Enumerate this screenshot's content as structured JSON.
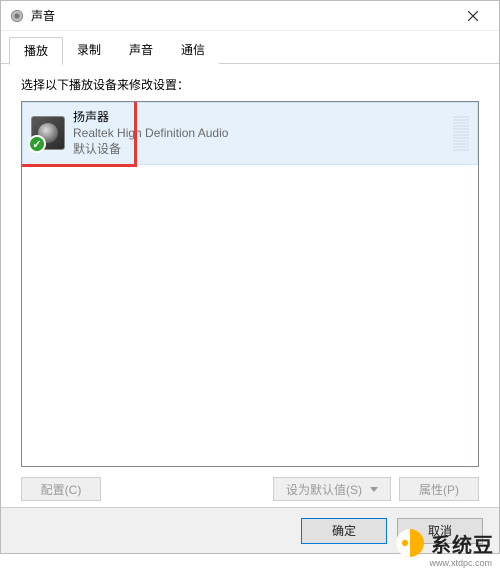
{
  "window": {
    "title": "声音"
  },
  "tabs": [
    {
      "label": "播放",
      "active": true
    },
    {
      "label": "录制",
      "active": false
    },
    {
      "label": "声音",
      "active": false
    },
    {
      "label": "通信",
      "active": false
    }
  ],
  "instruction": "选择以下播放设备来修改设置：",
  "device": {
    "name": "扬声器",
    "subtitle": "Realtek High Definition Audio",
    "status": "默认设备",
    "has_check": true
  },
  "buttons": {
    "configure": "配置(C)",
    "set_default": "设为默认值(S)",
    "properties": "属性(P)"
  },
  "footer": {
    "ok": "确定",
    "cancel": "取消"
  },
  "watermark": {
    "label": "系统豆",
    "url": "www.xtdpc.com"
  }
}
